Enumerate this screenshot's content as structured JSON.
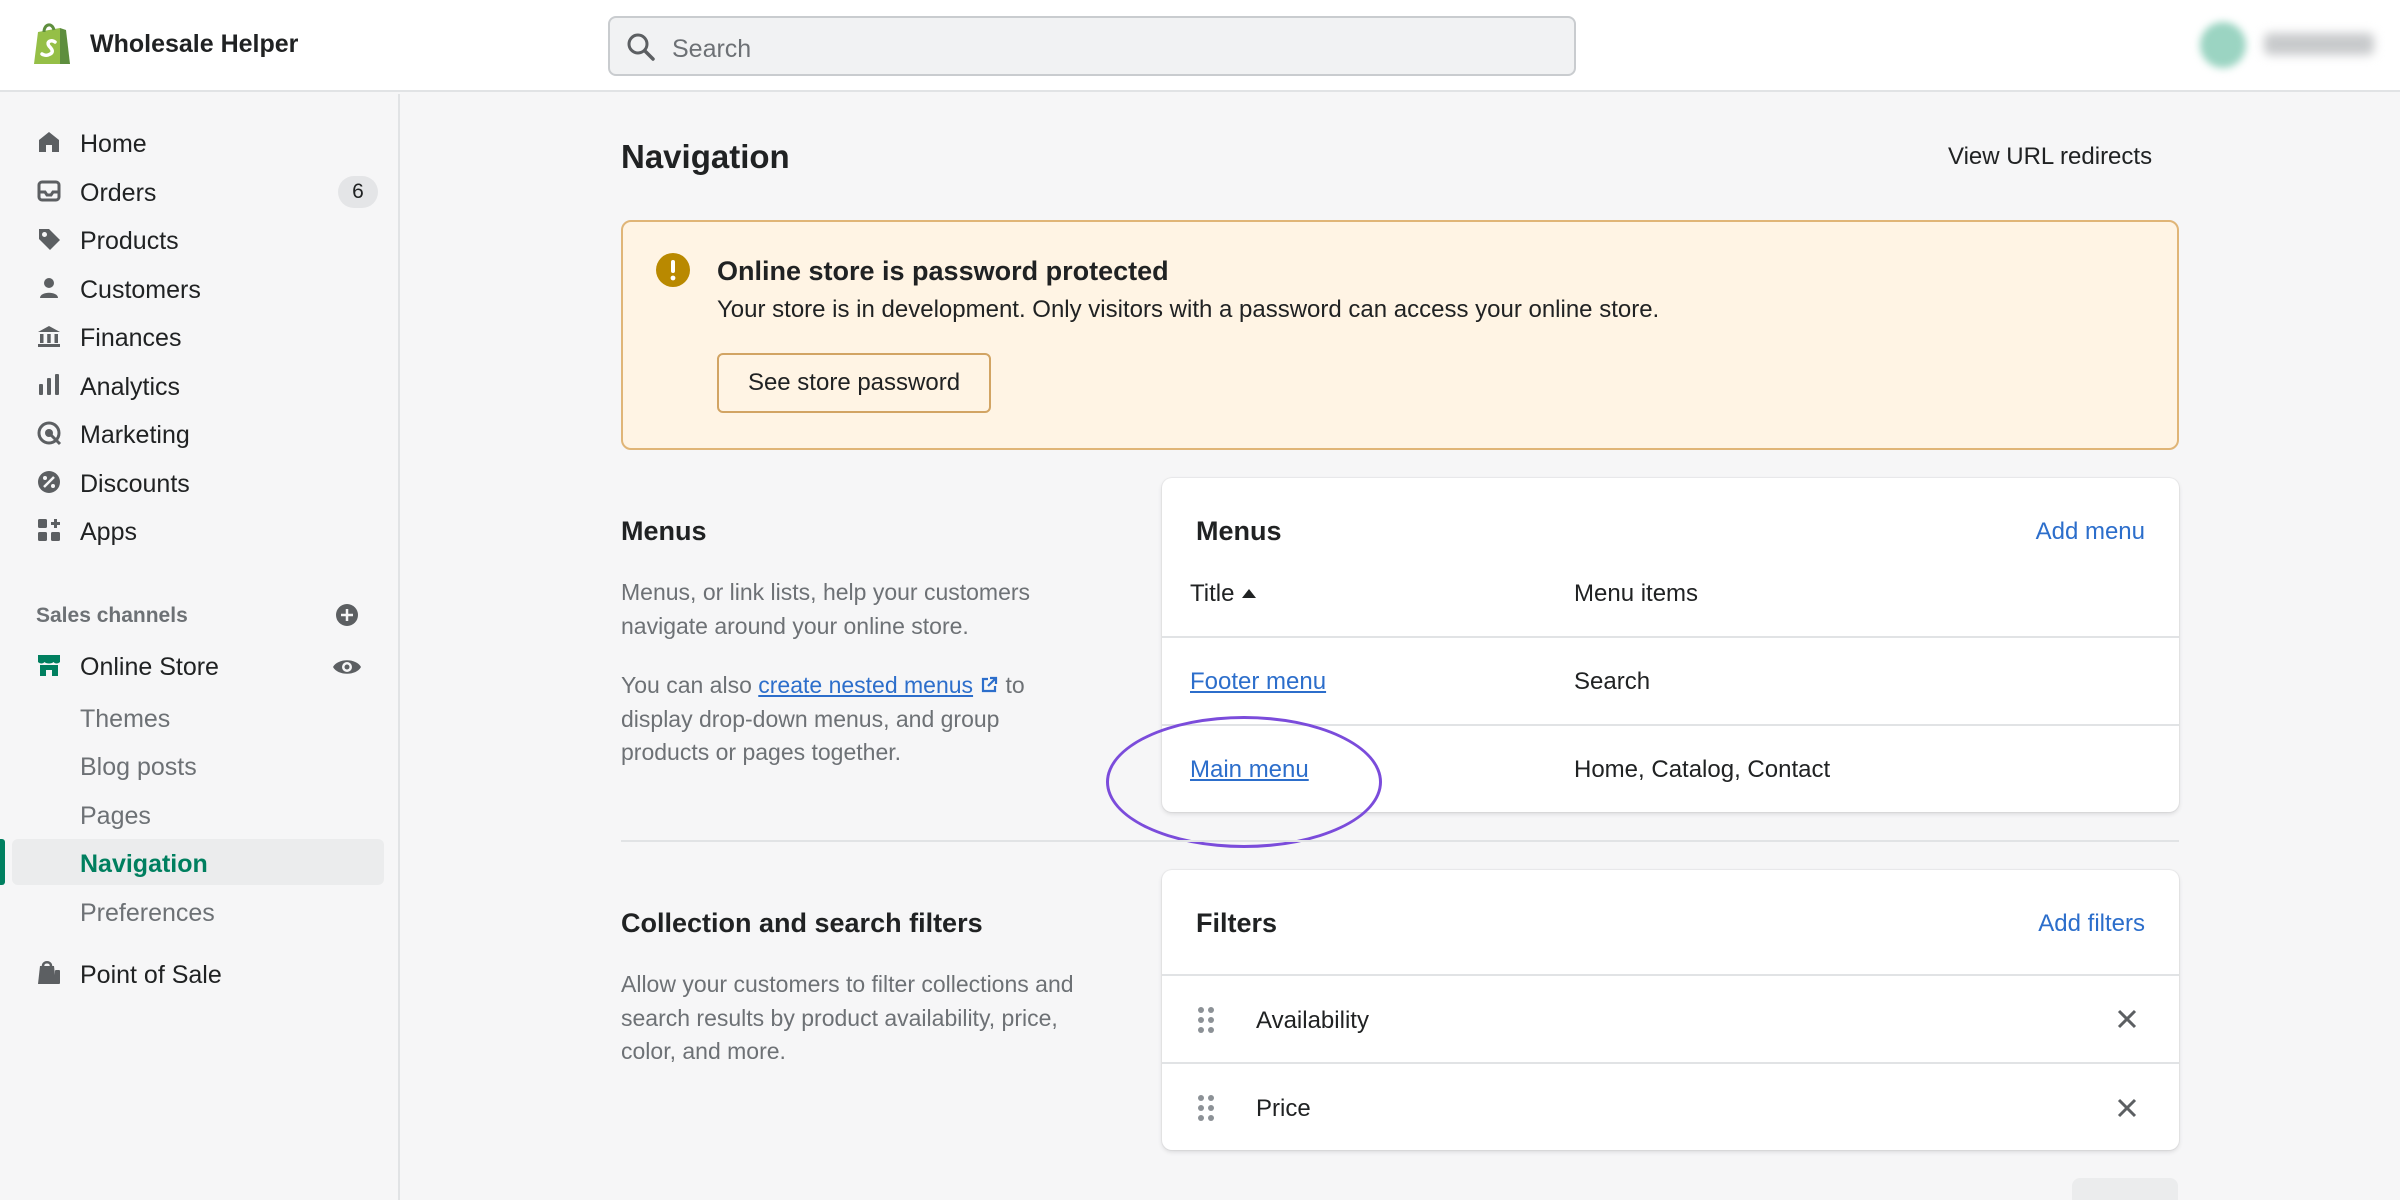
{
  "topbar": {
    "store_name": "Wholesale Helper",
    "search_placeholder": "Search",
    "logo_icon": "shopify-bag-icon"
  },
  "sidebar": {
    "items": [
      {
        "label": "Home",
        "icon": "home-icon"
      },
      {
        "label": "Orders",
        "icon": "orders-icon",
        "badge": "6"
      },
      {
        "label": "Products",
        "icon": "tag-icon"
      },
      {
        "label": "Customers",
        "icon": "person-icon"
      },
      {
        "label": "Finances",
        "icon": "bank-icon"
      },
      {
        "label": "Analytics",
        "icon": "bar-chart-icon"
      },
      {
        "label": "Marketing",
        "icon": "target-icon"
      },
      {
        "label": "Discounts",
        "icon": "discount-icon"
      },
      {
        "label": "Apps",
        "icon": "apps-icon"
      }
    ],
    "sales_channels_title": "Sales channels",
    "online_store": {
      "label": "Online Store",
      "icon": "store-icon"
    },
    "sub_items": [
      "Themes",
      "Blog posts",
      "Pages",
      "Navigation",
      "Preferences"
    ],
    "active_sub_item": "Navigation",
    "point_of_sale": {
      "label": "Point of Sale",
      "icon": "pos-icon"
    }
  },
  "main": {
    "title": "Navigation",
    "view_redirects": "View URL redirects",
    "banner": {
      "title": "Online store is password protected",
      "text": "Your store is in development. Only visitors with a password can access your online store.",
      "button": "See store password"
    },
    "menus_section": {
      "heading": "Menus",
      "desc1": "Menus, or link lists, help your customers navigate around your online store.",
      "desc2_prefix": "You can also ",
      "desc2_link": "create nested menus",
      "desc2_suffix": " to display drop-down menus, and group products or pages together."
    },
    "menus_card": {
      "title": "Menus",
      "action": "Add menu",
      "col_title": "Title",
      "col_items": "Menu items",
      "rows": [
        {
          "title": "Footer menu",
          "items": "Search"
        },
        {
          "title": "Main menu",
          "items": "Home, Catalog, Contact"
        }
      ]
    },
    "filters_section": {
      "heading": "Collection and search filters",
      "desc": "Allow your customers to filter collections and search results by product availability, price, color, and more."
    },
    "filters_card": {
      "title": "Filters",
      "action": "Add filters",
      "rows": [
        "Availability",
        "Price"
      ]
    }
  },
  "colors": {
    "accent_link": "#2c6ecb",
    "active_green": "#007f5f",
    "banner_bg": "#fff4e4",
    "annotation_circle": "#7b4cdb"
  }
}
